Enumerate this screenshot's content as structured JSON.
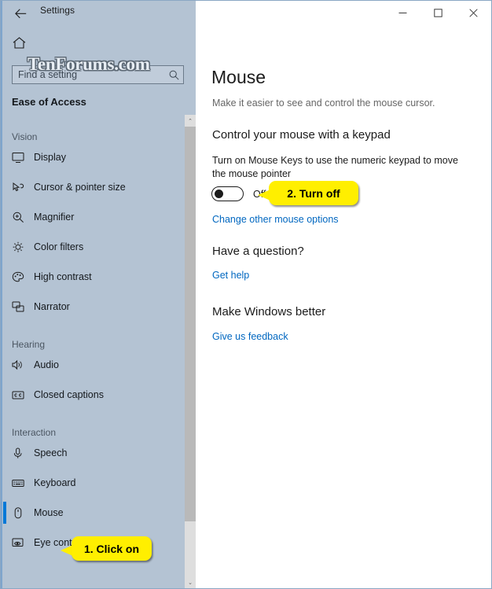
{
  "window": {
    "app_title": "Settings",
    "back_icon": "back-arrow-icon",
    "home_icon": "home-icon",
    "minimize_label": "—",
    "maximize_label": "❑",
    "close_label": "✕",
    "watermark": "TenForums.com"
  },
  "search": {
    "placeholder": "Find a setting",
    "value": "",
    "icon": "search-icon"
  },
  "sidebar": {
    "category": "Ease of Access",
    "groups": [
      {
        "label": "Vision",
        "items": [
          {
            "label": "Display",
            "icon": "monitor-icon",
            "selected": false
          },
          {
            "label": "Cursor & pointer size",
            "icon": "cursor-pointer-icon",
            "selected": false
          },
          {
            "label": "Magnifier",
            "icon": "magnifier-icon",
            "selected": false
          },
          {
            "label": "Color filters",
            "icon": "brightness-icon",
            "selected": false
          },
          {
            "label": "High contrast",
            "icon": "palette-icon",
            "selected": false
          },
          {
            "label": "Narrator",
            "icon": "narrator-icon",
            "selected": false
          }
        ]
      },
      {
        "label": "Hearing",
        "items": [
          {
            "label": "Audio",
            "icon": "speaker-icon",
            "selected": false
          },
          {
            "label": "Closed captions",
            "icon": "closed-caption-icon",
            "selected": false
          }
        ]
      },
      {
        "label": "Interaction",
        "items": [
          {
            "label": "Speech",
            "icon": "microphone-icon",
            "selected": false
          },
          {
            "label": "Keyboard",
            "icon": "keyboard-icon",
            "selected": false
          },
          {
            "label": "Mouse",
            "icon": "mouse-icon",
            "selected": true
          },
          {
            "label": "Eye control (beta)",
            "icon": "eye-control-icon",
            "selected": false
          }
        ]
      }
    ],
    "scrollbar": {
      "up_arrow": "⌃",
      "down_arrow": "⌄"
    }
  },
  "main": {
    "title": "Mouse",
    "subtitle": "Make it easier to see and control the mouse cursor.",
    "section_keypad": {
      "heading": "Control your mouse with a keypad",
      "description": "Turn on Mouse Keys to use the numeric keypad to move the mouse pointer",
      "toggle_state": "Off",
      "link": "Change other mouse options"
    },
    "section_question": {
      "heading": "Have a question?",
      "link": "Get help"
    },
    "section_feedback": {
      "heading": "Make Windows better",
      "link": "Give us feedback"
    }
  },
  "callouts": [
    {
      "text": "1. Click on"
    },
    {
      "text": "2. Turn off"
    }
  ],
  "colors": {
    "accent": "#0078d7",
    "sidebar_bg": "#b4c3d3",
    "link": "#0067c0",
    "callout_bg": "#ffef00"
  }
}
